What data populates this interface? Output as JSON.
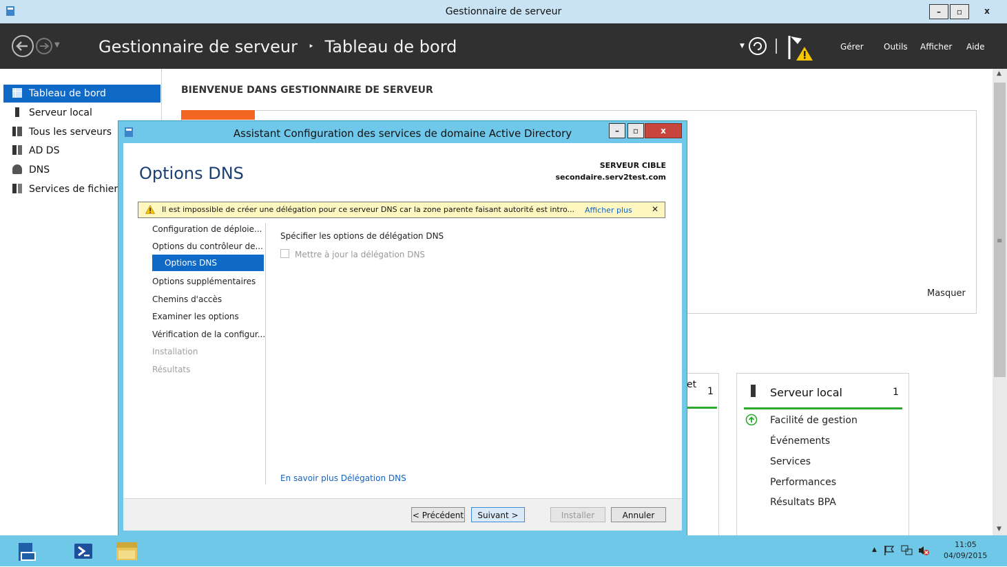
{
  "window": {
    "title": "Gestionnaire de serveur"
  },
  "header": {
    "breadcrumb_root": "Gestionnaire de serveur",
    "breadcrumb_sep": "‣",
    "breadcrumb_page": "Tableau de bord",
    "menu": [
      "Gérer",
      "Outils",
      "Afficher",
      "Aide"
    ]
  },
  "sidebar": {
    "items": [
      {
        "label": "Tableau de bord",
        "selected": true
      },
      {
        "label": "Serveur local"
      },
      {
        "label": "Tous les serveurs"
      },
      {
        "label": "AD DS"
      },
      {
        "label": "DNS"
      },
      {
        "label": "Services de fichiers"
      }
    ]
  },
  "main": {
    "welcome": "BIENVENUE DANS GESTIONNAIRE DE SERVEUR",
    "hide": "Masquer",
    "tile_left": {
      "partial_title": "et",
      "count": "1"
    },
    "tile_local": {
      "title": "Serveur local",
      "count": "1",
      "rows": [
        "Facilité de gestion",
        "Événements",
        "Services",
        "Performances",
        "Résultats BPA"
      ]
    }
  },
  "dialog": {
    "title": "Assistant Configuration des services de domaine Active Directory",
    "heading": "Options DNS",
    "target_label": "SERVEUR CIBLE",
    "target_value": "secondaire.serv2test.com",
    "warning": "Il est impossible de créer une délégation pour ce serveur DNS car la zone parente faisant autorité est intro...",
    "warning_more": "Afficher plus",
    "steps": [
      {
        "label": "Configuration de déploie...",
        "state": "normal"
      },
      {
        "label": "Options du contrôleur de...",
        "state": "normal"
      },
      {
        "label": "Options DNS",
        "state": "selected"
      },
      {
        "label": "Options supplémentaires",
        "state": "normal"
      },
      {
        "label": "Chemins d'accès",
        "state": "normal"
      },
      {
        "label": "Examiner les options",
        "state": "normal"
      },
      {
        "label": "Vérification de la configur...",
        "state": "normal"
      },
      {
        "label": "Installation",
        "state": "disabled"
      },
      {
        "label": "Résultats",
        "state": "disabled"
      }
    ],
    "section_title": "Spécifier les options de délégation DNS",
    "checkbox_label": "Mettre à jour la délégation DNS",
    "checkbox_checked": false,
    "learn_more": "En savoir plus Délégation DNS",
    "buttons": {
      "prev": "< Précédent",
      "next": "Suivant >",
      "install": "Installer",
      "cancel": "Annuler"
    }
  },
  "taskbar": {
    "time": "11:05",
    "date": "04/09/2015"
  },
  "colors": {
    "accent": "#0f69c6",
    "header_bg": "#303030",
    "dialog_frame": "#6fc8ea",
    "warning_bg": "#fff7c0",
    "status_green": "#2aa92a"
  }
}
